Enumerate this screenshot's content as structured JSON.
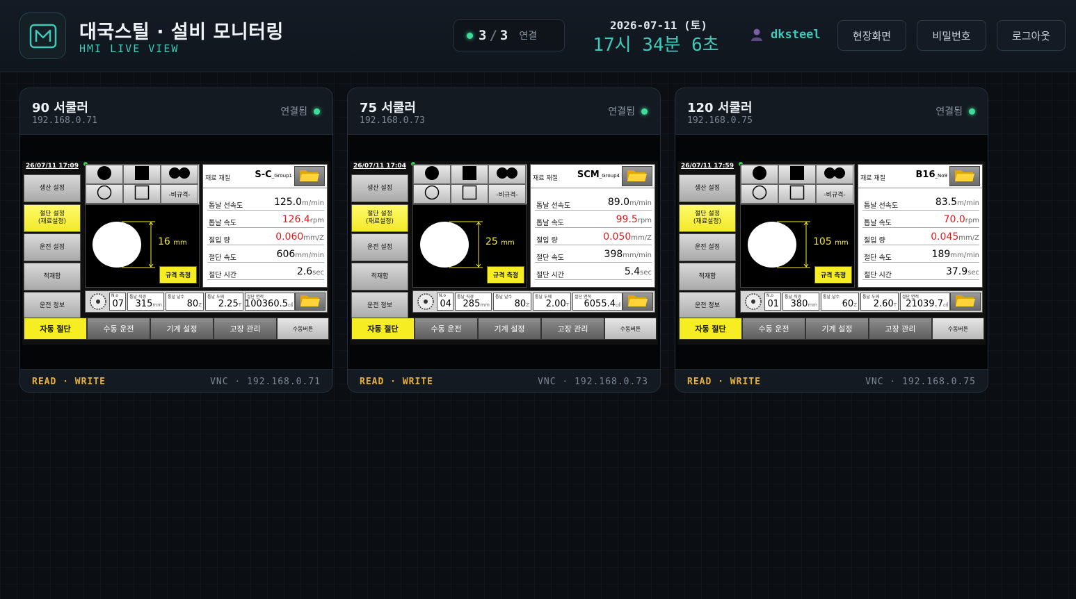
{
  "header": {
    "title": "대국스틸 · 설비 모니터링",
    "subtitle": "HMI LIVE VIEW",
    "conn_current": "3",
    "conn_total": "3",
    "conn_label": "연결",
    "date": "2026-07-11 (토)",
    "clock": "17시 34분 6초",
    "user": "dksteel",
    "buttons": {
      "site": "현장화면",
      "password": "비밀번호",
      "logout": "로그아웃"
    }
  },
  "colors": {
    "accent": "#3ec9b8",
    "status_ok": "#3ddc97",
    "warning_label": "#e8b13a",
    "hmi_yellow": "#f6ee22",
    "hmi_red": "#e01919"
  },
  "cards": [
    {
      "name": "90 서쿨러",
      "ip": "192.168.0.71",
      "status": "연결됨",
      "mode": "READ · WRITE",
      "vnc": "VNC · 192.168.0.71",
      "hmi": {
        "datetime": "26/07/11 17:09",
        "material_label": "재료 재질",
        "material": "S-C",
        "material_group": "_Group1",
        "diameter": "16",
        "diameter_unit": "mm",
        "params": [
          {
            "label": "톱날 선속도",
            "value": "125.0",
            "unit": "m/min",
            "red": false
          },
          {
            "label": "톱날 속도",
            "value": "126.4",
            "unit": "rpm",
            "red": true
          },
          {
            "label": "절입 량",
            "value": "0.060",
            "unit": "mm/Z",
            "red": true
          },
          {
            "label": "절단 속도",
            "value": "606",
            "unit": "mm/min",
            "red": false
          },
          {
            "label": "절단 시간",
            "value": "2.6",
            "unit": "sec",
            "red": false
          }
        ],
        "stats": [
          {
            "label": "N.o",
            "value": "07",
            "unit": ""
          },
          {
            "label": "톱날 직경",
            "value": "315",
            "unit": "mm"
          },
          {
            "label": "톱날 날수",
            "value": "80",
            "unit": "Z"
          },
          {
            "label": "톱날 두께",
            "value": "2.25",
            "unit": "T"
          },
          {
            "label": "절단 면적",
            "value": "100360.5",
            "unit": "㎠"
          }
        ]
      }
    },
    {
      "name": "75 서쿨러",
      "ip": "192.168.0.73",
      "status": "연결됨",
      "mode": "READ · WRITE",
      "vnc": "VNC · 192.168.0.73",
      "hmi": {
        "datetime": "26/07/11 17:04",
        "material_label": "재료 재질",
        "material": "SCM",
        "material_group": "_Group4",
        "diameter": "25",
        "diameter_unit": "mm",
        "params": [
          {
            "label": "톱날 선속도",
            "value": "89.0",
            "unit": "m/min",
            "red": false
          },
          {
            "label": "톱날 속도",
            "value": "99.5",
            "unit": "rpm",
            "red": true
          },
          {
            "label": "절입 량",
            "value": "0.050",
            "unit": "mm/Z",
            "red": true
          },
          {
            "label": "절단 속도",
            "value": "398",
            "unit": "mm/min",
            "red": false
          },
          {
            "label": "절단 시간",
            "value": "5.4",
            "unit": "sec",
            "red": false
          }
        ],
        "stats": [
          {
            "label": "N.o",
            "value": "04",
            "unit": ""
          },
          {
            "label": "톱날 직경",
            "value": "285",
            "unit": "mm"
          },
          {
            "label": "톱날 날수",
            "value": "80",
            "unit": "Z"
          },
          {
            "label": "톱날 두께",
            "value": "2.00",
            "unit": "T"
          },
          {
            "label": "절단 면적",
            "value": "6055.4",
            "unit": "㎠"
          }
        ]
      }
    },
    {
      "name": "120 서쿨러",
      "ip": "192.168.0.75",
      "status": "연결됨",
      "mode": "READ · WRITE",
      "vnc": "VNC · 192.168.0.75",
      "hmi": {
        "datetime": "26/07/11 17:59",
        "material_label": "재료 재질",
        "material": "B16",
        "material_group": "_No9",
        "diameter": "105",
        "diameter_unit": "mm",
        "params": [
          {
            "label": "톱날 선속도",
            "value": "83.5",
            "unit": "m/min",
            "red": false
          },
          {
            "label": "톱날 속도",
            "value": "70.0",
            "unit": "rpm",
            "red": true
          },
          {
            "label": "절입 량",
            "value": "0.045",
            "unit": "mm/Z",
            "red": true
          },
          {
            "label": "절단 속도",
            "value": "189",
            "unit": "mm/min",
            "red": false
          },
          {
            "label": "절단 시간",
            "value": "37.9",
            "unit": "sec",
            "red": false
          }
        ],
        "stats": [
          {
            "label": "N.o",
            "value": "01",
            "unit": ""
          },
          {
            "label": "톱날 직경",
            "value": "380",
            "unit": "mm"
          },
          {
            "label": "톱날 날수",
            "value": "60",
            "unit": "Z"
          },
          {
            "label": "톱날 두께",
            "value": "2.60",
            "unit": "T"
          },
          {
            "label": "절단 면적",
            "value": "21039.7",
            "unit": "㎠"
          }
        ]
      }
    }
  ],
  "hmi_common": {
    "side_buttons": [
      "생산 설정",
      "절단 설정\n(재료설정)",
      "운전 설정",
      "적재함",
      "운전 정보"
    ],
    "shape_label": "-비규격-",
    "measure_label": "규격 측정",
    "bottom_buttons": [
      "자동 절단",
      "수동 운전",
      "기계 설정",
      "고장 관리",
      "수동버튼"
    ]
  }
}
